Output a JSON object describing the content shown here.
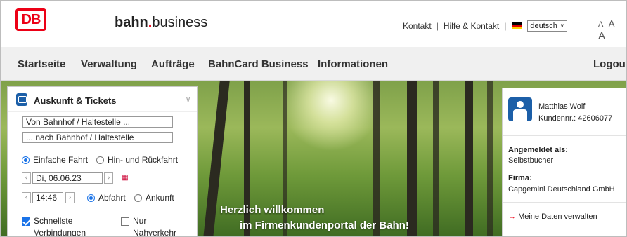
{
  "header": {
    "logo_text": "DB",
    "brand_bold": "bahn",
    "brand_dot": ".",
    "brand_rest": "business",
    "links": {
      "kontakt": "Kontakt",
      "hilfe": "Hilfe & Kontakt",
      "sep": "|"
    },
    "language": "deutsch",
    "font_sizes": [
      "A",
      "A",
      "A"
    ]
  },
  "nav": {
    "items": [
      {
        "label": "Startseite"
      },
      {
        "label": "Verwaltung"
      },
      {
        "label": "Aufträge"
      },
      {
        "label": "BahnCard Business"
      },
      {
        "label": "Informationen"
      }
    ],
    "logout": "Logout"
  },
  "search_panel": {
    "title": "Auskunft & Tickets",
    "from_placeholder": "Von Bahnhof / Haltestelle ...",
    "to_placeholder": "... nach Bahnhof / Haltestelle",
    "trip_type": {
      "single": "Einfache Fahrt",
      "return": "Hin- und Rückfahrt"
    },
    "date": "Di, 06.06.23",
    "time": "14:46",
    "time_mode": {
      "departure": "Abfahrt",
      "arrival": "Ankunft"
    },
    "options": {
      "fastest_line1": "Schnellste",
      "fastest_line2": "Verbindungen",
      "regional_line1": "Nur",
      "regional_line2": "Nahverkehr"
    }
  },
  "hero": {
    "line1": "Herzlich willkommen",
    "line2": "im Firmenkundenportal der Bahn!"
  },
  "user_panel": {
    "name": "Matthias Wolf",
    "customer_no": "Kundennr.: 42606077",
    "logged_in_label": "Angemeldet als:",
    "role": "Selbstbucher",
    "company_label": "Firma:",
    "company": "Capgemini Deutschland GmbH",
    "manage_link": "Meine Daten verwalten"
  }
}
